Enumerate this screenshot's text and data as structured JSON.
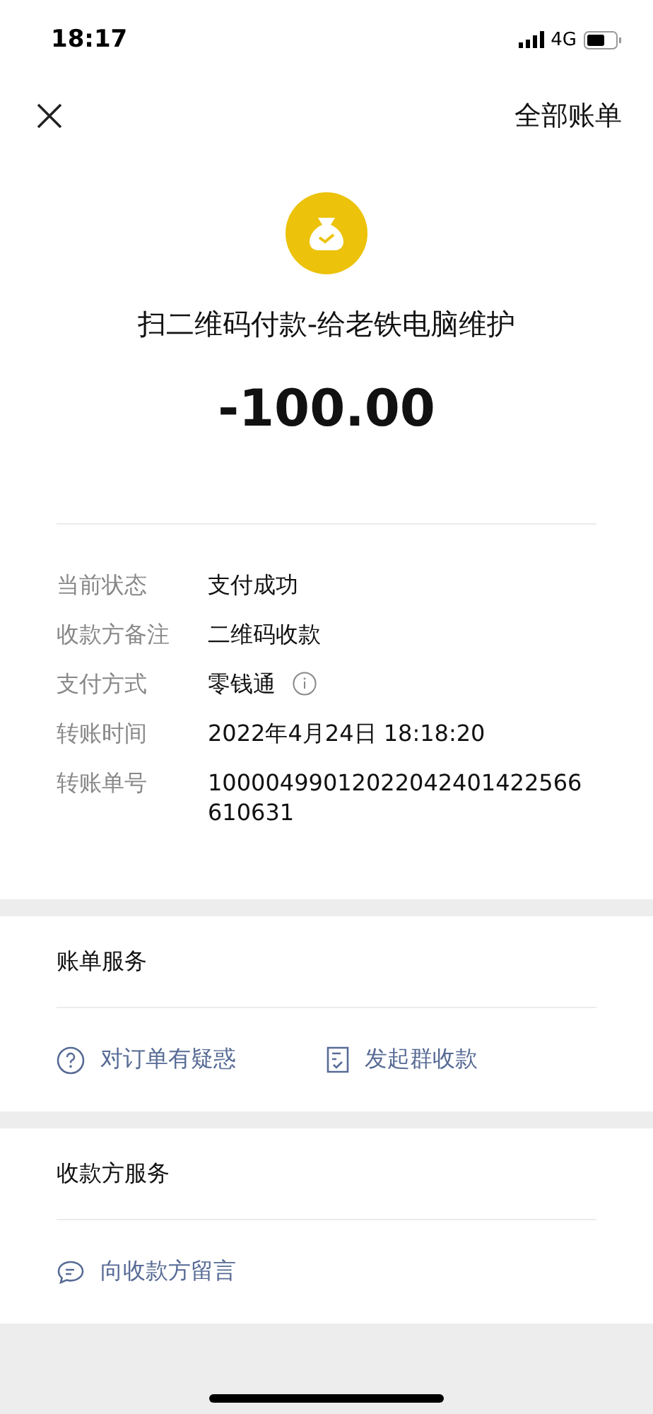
{
  "status_bar": {
    "time": "18:17",
    "network": "4G"
  },
  "nav": {
    "right_link": "全部账单"
  },
  "header": {
    "title": "扫二维码付款-给老铁电脑维护",
    "amount": "-100.00"
  },
  "details": [
    {
      "label": "当前状态",
      "value": "支付成功",
      "info": false
    },
    {
      "label": "收款方备注",
      "value": "二维码收款",
      "info": false
    },
    {
      "label": "支付方式",
      "value": "零钱通",
      "info": true
    },
    {
      "label": "转账时间",
      "value": "2022年4月24日 18:18:20",
      "info": false
    },
    {
      "label": "转账单号",
      "value": "10000499012022042401422566",
      "info": false,
      "continued": "610631"
    }
  ],
  "sections": [
    {
      "title": "账单服务",
      "actions": [
        {
          "kind": "question",
          "label": "对订单有疑惑"
        },
        {
          "kind": "bill",
          "label": "发起群收款"
        }
      ]
    },
    {
      "title": "收款方服务",
      "actions": [
        {
          "kind": "message",
          "label": "向收款方留言"
        }
      ]
    }
  ]
}
